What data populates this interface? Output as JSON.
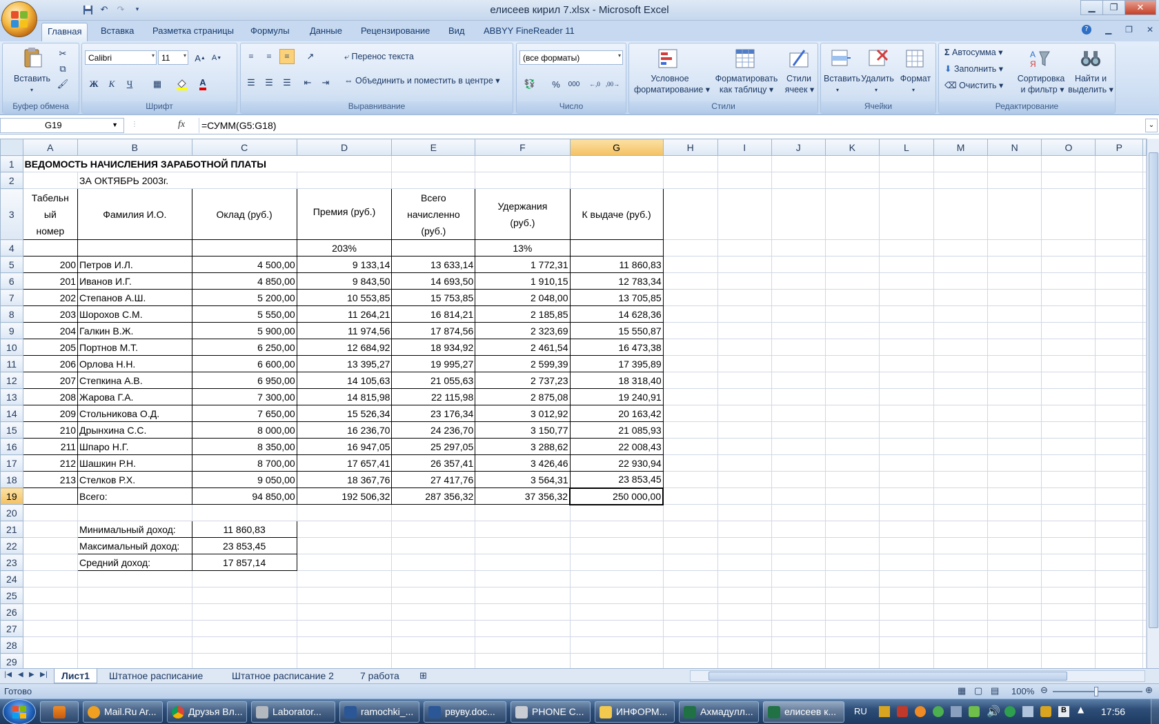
{
  "window": {
    "title": "елисеев кирил 7.xlsx - Microsoft Excel"
  },
  "ribbon": {
    "tabs": [
      "Главная",
      "Вставка",
      "Разметка страницы",
      "Формулы",
      "Данные",
      "Рецензирование",
      "Вид",
      "ABBYY FineReader 11"
    ],
    "clipboard": {
      "paste": "Вставить",
      "label": "Буфер обмена"
    },
    "font": {
      "name": "Calibri",
      "size": "11",
      "bold": "Ж",
      "italic": "К",
      "underline": "Ч",
      "label": "Шрифт"
    },
    "alignment": {
      "wrap": "Перенос текста",
      "merge": "Объединить и поместить в центре",
      "label": "Выравнивание"
    },
    "number": {
      "format": "(все форматы)",
      "percent": "%",
      "thousands": "000",
      "label": "Число"
    },
    "styles": {
      "conditional_1": "Условное",
      "conditional_2": "форматирование",
      "table_1": "Форматировать",
      "table_2": "как таблицу",
      "cell_1": "Стили",
      "cell_2": "ячеек",
      "label": "Стили"
    },
    "cells": {
      "insert": "Вставить",
      "delete": "Удалить",
      "format": "Формат",
      "label": "Ячейки"
    },
    "editing": {
      "autosum": "Автосумма",
      "fill": "Заполнить",
      "clear": "Очистить",
      "sort_1": "Сортировка",
      "sort_2": "и фильтр",
      "find_1": "Найти и",
      "find_2": "выделить",
      "label": "Редактирование"
    }
  },
  "formula_bar": {
    "name_box": "G19",
    "fx": "fx",
    "formula": "=СУММ(G5:G18)"
  },
  "sheet": {
    "columns": [
      "A",
      "B",
      "C",
      "D",
      "E",
      "F",
      "G",
      "H",
      "I",
      "J",
      "K",
      "L",
      "M",
      "N",
      "O",
      "P"
    ],
    "rows": [
      "1",
      "2",
      "3",
      "4",
      "5",
      "6",
      "7",
      "8",
      "9",
      "10",
      "11",
      "12",
      "13",
      "14",
      "15",
      "16",
      "17",
      "18",
      "19",
      "20",
      "21",
      "22",
      "23",
      "24",
      "25",
      "26",
      "27",
      "28",
      "29"
    ],
    "title": "ВЕДОМОСТЬ НАЧИСЛЕНИЯ ЗАРАБОТНОЙ ПЛАТЫ",
    "subtitle": "ЗА ОКТЯБРЬ 2003г.",
    "headers": [
      "Табельный номер",
      "Фамилия И.О.",
      "Оклад (руб.)",
      "Премия (руб.)",
      "Всего начисленно (руб.)",
      "Удержания (руб.)",
      "К выдаче (руб.)"
    ],
    "header_lines": {
      "a": [
        "Табельн",
        "ый",
        "номер"
      ],
      "e": [
        "Всего",
        "начисленно",
        "(руб.)"
      ],
      "f": [
        "Удержания",
        "(руб.)"
      ]
    },
    "rates": {
      "bonus": "203%",
      "deduction": "13%"
    },
    "data": [
      [
        "200",
        "Петров И.Л.",
        "4 500,00",
        "9 133,14",
        "13 633,14",
        "1 772,31",
        "11 860,83"
      ],
      [
        "201",
        "Иванов И.Г.",
        "4 850,00",
        "9 843,50",
        "14 693,50",
        "1 910,15",
        "12 783,34"
      ],
      [
        "202",
        "Степанов А.Ш.",
        "5 200,00",
        "10 553,85",
        "15 753,85",
        "2 048,00",
        "13 705,85"
      ],
      [
        "203",
        "Шорохов С.М.",
        "5 550,00",
        "11 264,21",
        "16 814,21",
        "2 185,85",
        "14 628,36"
      ],
      [
        "204",
        "Галкин В.Ж.",
        "5 900,00",
        "11 974,56",
        "17 874,56",
        "2 323,69",
        "15 550,87"
      ],
      [
        "205",
        "Портнов М.Т.",
        "6 250,00",
        "12 684,92",
        "18 934,92",
        "2 461,54",
        "16 473,38"
      ],
      [
        "206",
        "Орлова Н.Н.",
        "6 600,00",
        "13 395,27",
        "19 995,27",
        "2 599,39",
        "17 395,89"
      ],
      [
        "207",
        "Степкина А.В.",
        "6 950,00",
        "14 105,63",
        "21 055,63",
        "2 737,23",
        "18 318,40"
      ],
      [
        "208",
        "Жарова Г.А.",
        "7 300,00",
        "14 815,98",
        "22 115,98",
        "2 875,08",
        "19 240,91"
      ],
      [
        "209",
        "Стольникова О.Д.",
        "7 650,00",
        "15 526,34",
        "23 176,34",
        "3 012,92",
        "20 163,42"
      ],
      [
        "210",
        "Дрынхина С.С.",
        "8 000,00",
        "16 236,70",
        "24 236,70",
        "3 150,77",
        "21 085,93"
      ],
      [
        "211",
        "Шпаро Н.Г.",
        "8 350,00",
        "16 947,05",
        "25 297,05",
        "3 288,62",
        "22 008,43"
      ],
      [
        "212",
        "Шашкин Р.Н.",
        "8 700,00",
        "17 657,41",
        "26 357,41",
        "3 426,46",
        "22 930,94"
      ],
      [
        "213",
        "Стелков Р.Х.",
        "9 050,00",
        "18 367,76",
        "27 417,76",
        "3 564,31",
        "23 853,45"
      ]
    ],
    "total": {
      "label": "Всего:",
      "c": "94 850,00",
      "d": "192 506,32",
      "e": "287 356,32",
      "f": "37 356,32",
      "g": "250 000,00"
    },
    "stats": [
      {
        "label": "Минимальный доход:",
        "value": "11 860,83"
      },
      {
        "label": "Максимальный доход:",
        "value": "23 853,45"
      },
      {
        "label": "Средний доход:",
        "value": "17 857,14"
      }
    ],
    "tabs": [
      "Лист1",
      "Штатное расписание",
      "Штатное расписание 2",
      "7 работа"
    ]
  },
  "status": {
    "ready": "Готово",
    "zoom": "100%"
  },
  "taskbar": {
    "items": [
      "Mail.Ru Ar...",
      "Друзья Вл...",
      "Laborator...",
      "ramochki_...",
      "рвуву.doc...",
      "PHONE C...",
      "ИНФОРМ...",
      "Ахмадулл...",
      "елисеев к..."
    ],
    "lang": "RU",
    "time": "17:56"
  },
  "colors": {
    "accent": "#c6d9f0",
    "selected_header": "#f4c163",
    "taskbar": "#1d3a60"
  }
}
